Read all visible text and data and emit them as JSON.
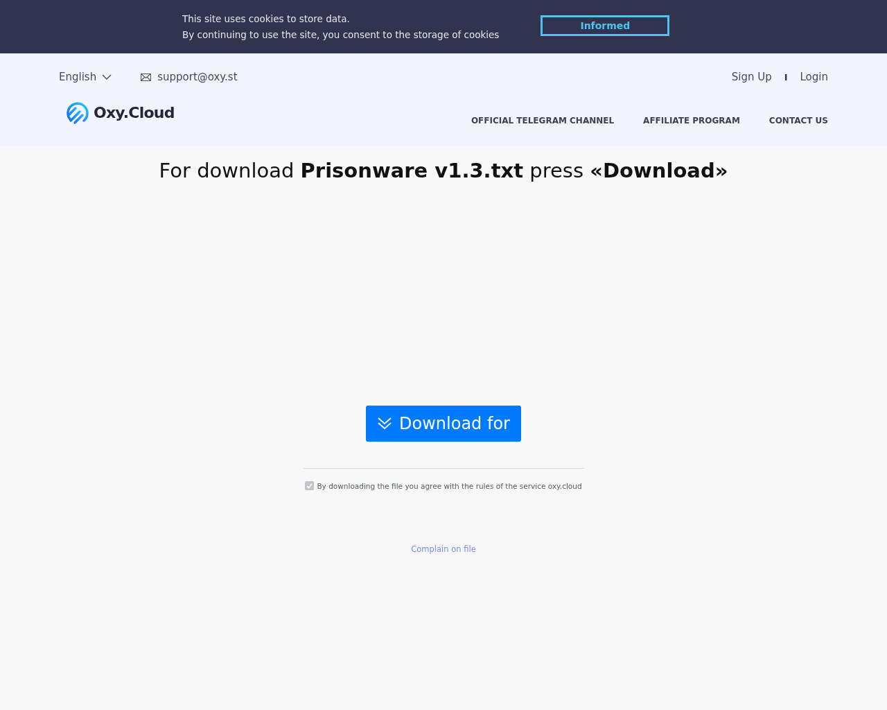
{
  "cookie_banner": {
    "lines": [
      "This site uses cookies to store data.",
      "By continuing to use the site, you consent to the storage of cookies"
    ],
    "button": "Informed"
  },
  "header": {
    "language": "English",
    "email": "support@oxy.st",
    "auth_links": [
      "Sign Up",
      "Login"
    ],
    "separator": "I",
    "logo": "Oxy.Cloud",
    "nav": [
      "OFFICIAL TELEGRAM CHANNEL",
      "AFFILIATE PROGRAM",
      "CONTACT US"
    ]
  },
  "heading": "For download **Prisonware v1.3.txt** press **«Download»**",
  "download_button": "Download for",
  "agreement": {
    "checked": true,
    "disabled": true,
    "text": "By downloading the file you agree with the rules of the service oxy.cloud"
  },
  "complain_link": "Complain on file"
}
